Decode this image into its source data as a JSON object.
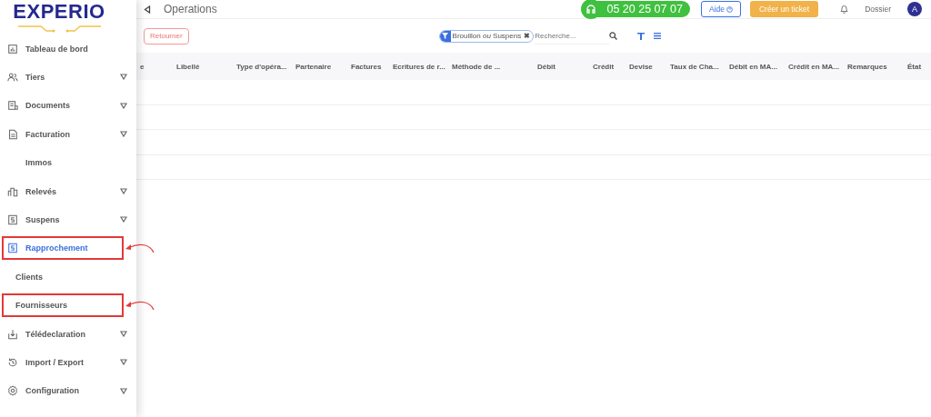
{
  "logo": "EXPERIO",
  "sidebar": {
    "items": [
      {
        "label": "Tableau de bord",
        "kind": "section",
        "expandable": false,
        "selected": false,
        "highlighted": false
      },
      {
        "label": "Tiers",
        "kind": "section",
        "expandable": true,
        "selected": false,
        "highlighted": false
      },
      {
        "label": "Documents",
        "kind": "section",
        "expandable": true,
        "selected": false,
        "highlighted": false
      },
      {
        "label": "Facturation",
        "kind": "section",
        "expandable": true,
        "selected": false,
        "highlighted": false
      },
      {
        "label": "Immos",
        "kind": "subitem",
        "expandable": false,
        "selected": false,
        "highlighted": false
      },
      {
        "label": "Relevés",
        "kind": "section",
        "expandable": true,
        "selected": false,
        "highlighted": false
      },
      {
        "label": "Suspens",
        "kind": "section",
        "expandable": true,
        "selected": false,
        "highlighted": false
      },
      {
        "label": "Rapprochement",
        "kind": "section",
        "expandable": false,
        "selected": true,
        "highlighted": true
      },
      {
        "label": "Clients",
        "kind": "subitem",
        "expandable": false,
        "selected": false,
        "highlighted": false
      },
      {
        "label": "Fournisseurs",
        "kind": "subitem",
        "expandable": false,
        "selected": false,
        "highlighted": true
      },
      {
        "label": "Télédeclaration",
        "kind": "section",
        "expandable": true,
        "selected": false,
        "highlighted": false
      },
      {
        "label": "Import / Export",
        "kind": "section",
        "expandable": true,
        "selected": false,
        "highlighted": false
      },
      {
        "label": "Configuration",
        "kind": "section",
        "expandable": true,
        "selected": false,
        "highlighted": false
      }
    ]
  },
  "header": {
    "title": "Operations",
    "phone": "05 20 25 07 07",
    "help": "Aide",
    "create_ticket": "Créer un ticket",
    "folder": "Dossier",
    "avatar": "A"
  },
  "toolbar": {
    "back": "Retourner",
    "filter_chip": "Brouillon *ou* Suspens",
    "remove_filter": "✖",
    "search": {
      "placeholder": "Recherche..."
    }
  },
  "table": {
    "columns": [
      "e",
      "Libellé",
      "Type d'opéra...",
      "Partenaire",
      "Factures",
      "Ecritures de r...",
      "Méthode de ...",
      "Débit",
      "Crédit",
      "Devise",
      "Taux de Cha...",
      "Débit en MA...",
      "Crédit en MA...",
      "Remarques",
      "État"
    ]
  }
}
